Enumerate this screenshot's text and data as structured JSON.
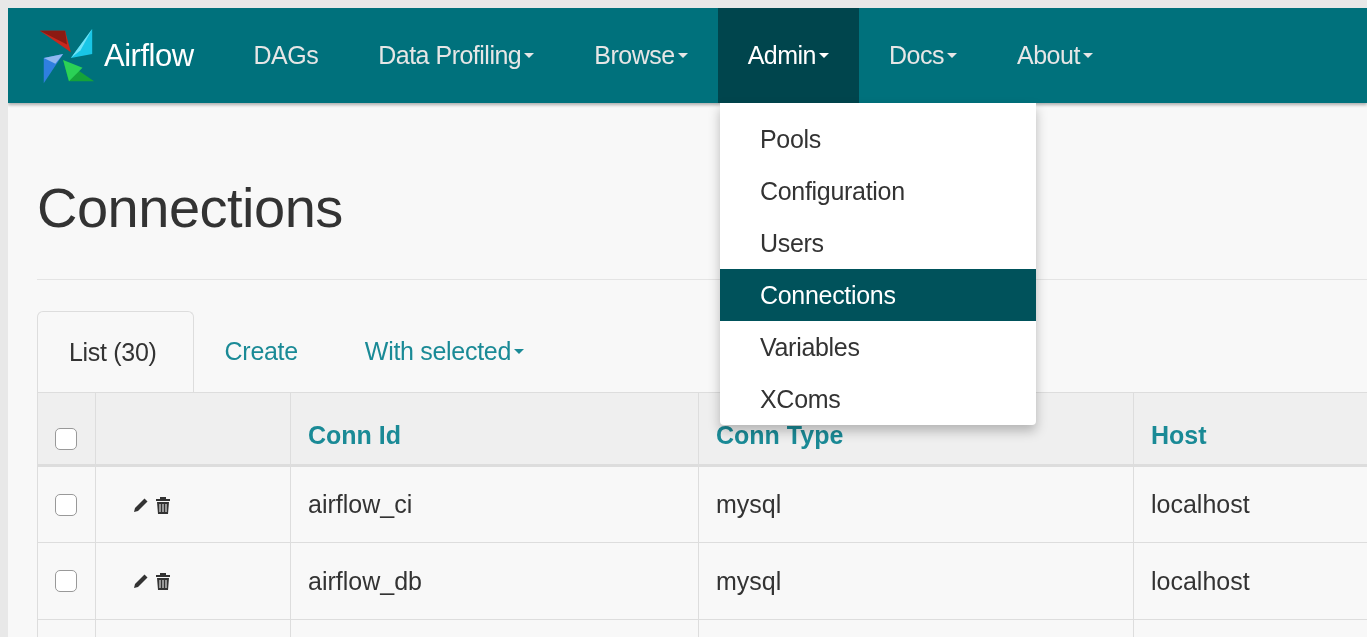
{
  "navbar": {
    "brand": "Airflow",
    "items": [
      {
        "label": "DAGs",
        "dropdown": false,
        "selected": false
      },
      {
        "label": "Data Profiling",
        "dropdown": true,
        "selected": false
      },
      {
        "label": "Browse",
        "dropdown": true,
        "selected": false
      },
      {
        "label": "Admin",
        "dropdown": true,
        "selected": true
      },
      {
        "label": "Docs",
        "dropdown": true,
        "selected": false
      },
      {
        "label": "About",
        "dropdown": true,
        "selected": false
      }
    ]
  },
  "admin_menu": [
    {
      "label": "Pools",
      "selected": false
    },
    {
      "label": "Configuration",
      "selected": false
    },
    {
      "label": "Users",
      "selected": false
    },
    {
      "label": "Connections",
      "selected": true
    },
    {
      "label": "Variables",
      "selected": false
    },
    {
      "label": "XComs",
      "selected": false
    }
  ],
  "page_title": "Connections",
  "tabs": [
    {
      "label": "List (30)",
      "selected": true,
      "dropdown": false
    },
    {
      "label": "Create",
      "selected": false,
      "dropdown": false
    },
    {
      "label": "With selected",
      "selected": false,
      "dropdown": true
    }
  ],
  "table": {
    "select_all_checked": false,
    "columns": [
      "Conn Id",
      "Conn Type",
      "Host"
    ],
    "rows": [
      {
        "checked": false,
        "cells": [
          "airflow_ci",
          "mysql",
          "localhost"
        ]
      },
      {
        "checked": false,
        "cells": [
          "airflow_db",
          "mysql",
          "localhost"
        ]
      }
    ]
  }
}
